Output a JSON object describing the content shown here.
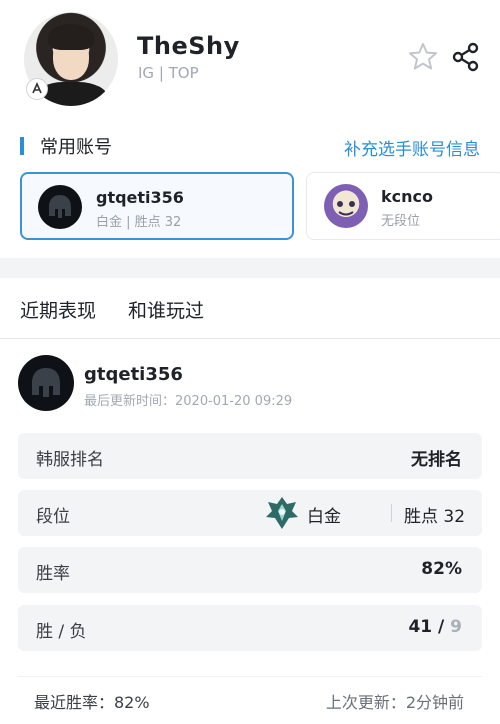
{
  "player": {
    "name": "TheShy",
    "subtitle": "IG | TOP"
  },
  "accounts": {
    "title": "常用账号",
    "add_link": "补充选手账号信息",
    "items": [
      {
        "name": "gtqeti356",
        "rank": "白金 | 胜点 32",
        "active": true
      },
      {
        "name": "kcnco",
        "rank": "无段位",
        "active": false
      }
    ]
  },
  "tabs": [
    "近期表现",
    "和谁玩过"
  ],
  "recent": {
    "account_name": "gtqeti356",
    "updated": "最后更新时间：2020-01-20 09:29"
  },
  "stats": {
    "server_rank": {
      "label": "韩服排名",
      "value": "无排名"
    },
    "tier": {
      "label": "段位",
      "name": "白金",
      "points": "胜点 32"
    },
    "win_rate": {
      "label": "胜率",
      "value": "82%"
    },
    "record": {
      "label": "胜 / 负",
      "wins": "41",
      "sep": " / ",
      "losses": "9"
    }
  },
  "footer": {
    "recent_win_rate": "最近胜率：82%",
    "last_update": "上次更新：2分钟前"
  },
  "colors": {
    "accent": "#2a8fd4",
    "active_border": "#3b93d6",
    "row_bg": "#f3f4f6"
  },
  "icons": [
    "star-icon",
    "share-icon",
    "team-logo-icon",
    "helmet-icon",
    "tier-emblem-icon"
  ]
}
